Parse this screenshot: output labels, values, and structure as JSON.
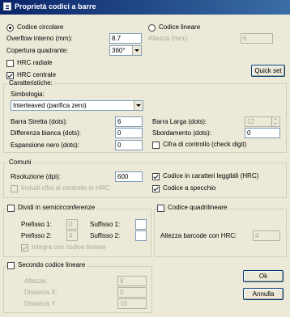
{
  "window": {
    "title": "Proprietà codici a barre"
  },
  "top": {
    "codice_circolare": "Codice circolare",
    "codice_lineare": "Codice lineare",
    "overflow_label": "Overflow interno (mm):",
    "overflow_value": "8.7",
    "altezza_label": "Altezza (mm):",
    "altezza_value": "6",
    "copertura_label": "Copertura quadrante:",
    "copertura_value": "360°",
    "hrc_radiale": "HRC radiale",
    "hrc_centrale": "HRC centrale",
    "quick_set": "Quick set"
  },
  "caratteristiche": {
    "title": "Caratteristiche:",
    "simbologia_label": "Simbologia:",
    "simbologia_value": "Interleaved (parifica zero)",
    "barra_stretta_label": "Barra Stretta (dots):",
    "barra_stretta_value": "6",
    "barra_larga_label": "Barra Larga (dots):",
    "barra_larga_value": "12",
    "diff_bianca_label": "Differenza bianca (dots):",
    "diff_bianca_value": "0",
    "sbordamento_label": "Sbordamento (dots):",
    "sbordamento_value": "0",
    "espansione_label": "Espansione nero (dots):",
    "espansione_value": "0",
    "cifra_controllo": "Cifra di controllo (check digit)"
  },
  "comuni": {
    "title": "Comuni",
    "risoluzione_label": "Risoluzione (dpi):",
    "risoluzione_value": "600",
    "includi_cifra": "Includi cifra di controllo in HRC",
    "caratteri_leggibili": "Codice in caratteri leggibili (HRC)",
    "codice_specchio": "Codice a specchio"
  },
  "semicirconferenze": {
    "title": "Dividi in semicirconferenze",
    "prefisso1_label": "Prefisso 1:",
    "prefisso1_value": "0",
    "suffisso1_label": "Suffisso 1:",
    "suffisso1_value": "",
    "prefisso2_label": "Prefisso 2:",
    "prefisso2_value": "4",
    "suffisso2_label": "Suffisso 2:",
    "suffisso2_value": "",
    "integra": "Integra con codice lineare"
  },
  "quadrilineare": {
    "title": "Codice quadrilineare",
    "altezza_hrc_label": "Altezza barcode con HRC:",
    "altezza_hrc_value": "4"
  },
  "secondo": {
    "title": "Secondo codice lineare",
    "altezza_label": "Altezza:",
    "altezza_value": "8",
    "distanza_x_label": "Distanza X:",
    "distanza_x_value": "0",
    "distanza_y_label": "Distanza Y:",
    "distanza_y_value": "10"
  },
  "buttons": {
    "ok": "Ok",
    "annulla": "Annulla"
  }
}
